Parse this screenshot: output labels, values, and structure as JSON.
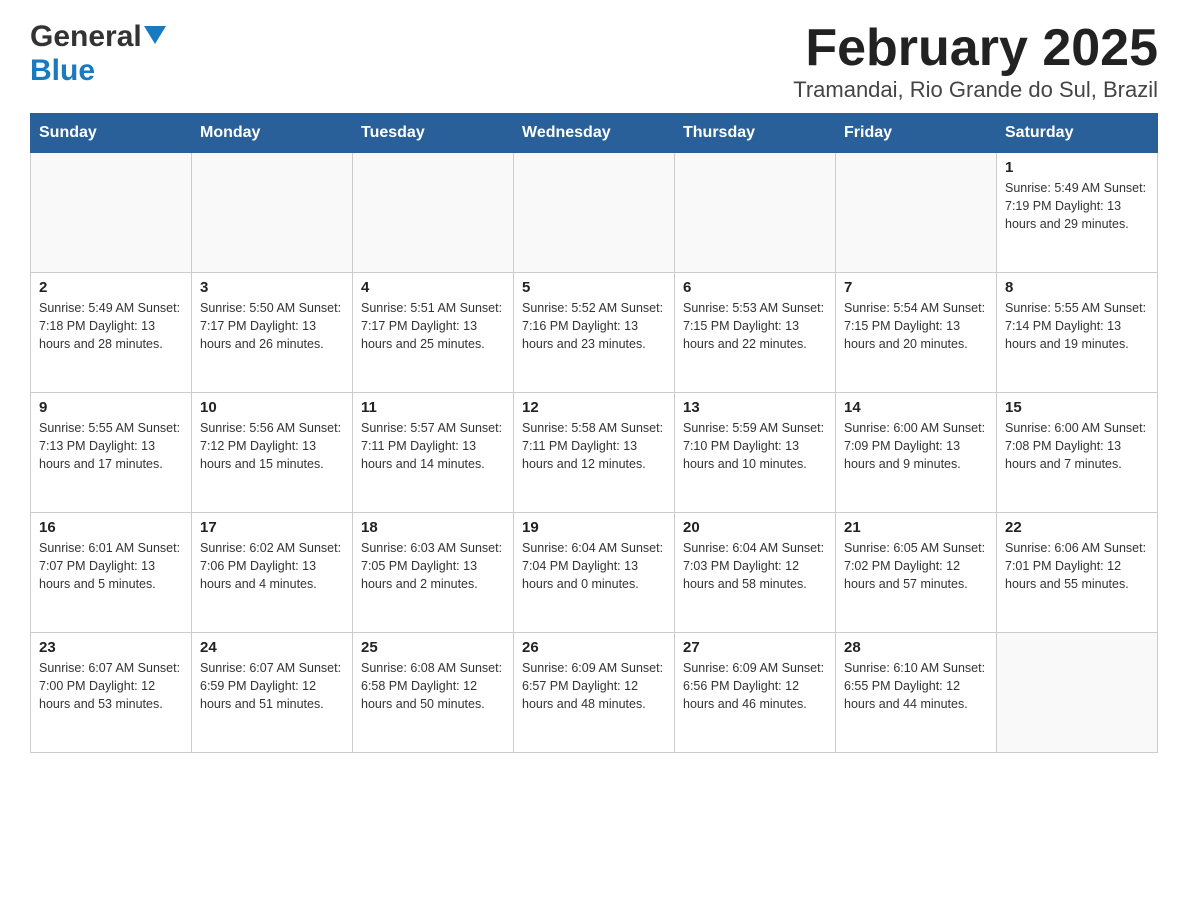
{
  "header": {
    "logo_general": "General",
    "logo_blue": "Blue",
    "title": "February 2025",
    "subtitle": "Tramandai, Rio Grande do Sul, Brazil"
  },
  "days_of_week": [
    "Sunday",
    "Monday",
    "Tuesday",
    "Wednesday",
    "Thursday",
    "Friday",
    "Saturday"
  ],
  "weeks": [
    [
      {
        "day": "",
        "info": ""
      },
      {
        "day": "",
        "info": ""
      },
      {
        "day": "",
        "info": ""
      },
      {
        "day": "",
        "info": ""
      },
      {
        "day": "",
        "info": ""
      },
      {
        "day": "",
        "info": ""
      },
      {
        "day": "1",
        "info": "Sunrise: 5:49 AM\nSunset: 7:19 PM\nDaylight: 13 hours and 29 minutes."
      }
    ],
    [
      {
        "day": "2",
        "info": "Sunrise: 5:49 AM\nSunset: 7:18 PM\nDaylight: 13 hours and 28 minutes."
      },
      {
        "day": "3",
        "info": "Sunrise: 5:50 AM\nSunset: 7:17 PM\nDaylight: 13 hours and 26 minutes."
      },
      {
        "day": "4",
        "info": "Sunrise: 5:51 AM\nSunset: 7:17 PM\nDaylight: 13 hours and 25 minutes."
      },
      {
        "day": "5",
        "info": "Sunrise: 5:52 AM\nSunset: 7:16 PM\nDaylight: 13 hours and 23 minutes."
      },
      {
        "day": "6",
        "info": "Sunrise: 5:53 AM\nSunset: 7:15 PM\nDaylight: 13 hours and 22 minutes."
      },
      {
        "day": "7",
        "info": "Sunrise: 5:54 AM\nSunset: 7:15 PM\nDaylight: 13 hours and 20 minutes."
      },
      {
        "day": "8",
        "info": "Sunrise: 5:55 AM\nSunset: 7:14 PM\nDaylight: 13 hours and 19 minutes."
      }
    ],
    [
      {
        "day": "9",
        "info": "Sunrise: 5:55 AM\nSunset: 7:13 PM\nDaylight: 13 hours and 17 minutes."
      },
      {
        "day": "10",
        "info": "Sunrise: 5:56 AM\nSunset: 7:12 PM\nDaylight: 13 hours and 15 minutes."
      },
      {
        "day": "11",
        "info": "Sunrise: 5:57 AM\nSunset: 7:11 PM\nDaylight: 13 hours and 14 minutes."
      },
      {
        "day": "12",
        "info": "Sunrise: 5:58 AM\nSunset: 7:11 PM\nDaylight: 13 hours and 12 minutes."
      },
      {
        "day": "13",
        "info": "Sunrise: 5:59 AM\nSunset: 7:10 PM\nDaylight: 13 hours and 10 minutes."
      },
      {
        "day": "14",
        "info": "Sunrise: 6:00 AM\nSunset: 7:09 PM\nDaylight: 13 hours and 9 minutes."
      },
      {
        "day": "15",
        "info": "Sunrise: 6:00 AM\nSunset: 7:08 PM\nDaylight: 13 hours and 7 minutes."
      }
    ],
    [
      {
        "day": "16",
        "info": "Sunrise: 6:01 AM\nSunset: 7:07 PM\nDaylight: 13 hours and 5 minutes."
      },
      {
        "day": "17",
        "info": "Sunrise: 6:02 AM\nSunset: 7:06 PM\nDaylight: 13 hours and 4 minutes."
      },
      {
        "day": "18",
        "info": "Sunrise: 6:03 AM\nSunset: 7:05 PM\nDaylight: 13 hours and 2 minutes."
      },
      {
        "day": "19",
        "info": "Sunrise: 6:04 AM\nSunset: 7:04 PM\nDaylight: 13 hours and 0 minutes."
      },
      {
        "day": "20",
        "info": "Sunrise: 6:04 AM\nSunset: 7:03 PM\nDaylight: 12 hours and 58 minutes."
      },
      {
        "day": "21",
        "info": "Sunrise: 6:05 AM\nSunset: 7:02 PM\nDaylight: 12 hours and 57 minutes."
      },
      {
        "day": "22",
        "info": "Sunrise: 6:06 AM\nSunset: 7:01 PM\nDaylight: 12 hours and 55 minutes."
      }
    ],
    [
      {
        "day": "23",
        "info": "Sunrise: 6:07 AM\nSunset: 7:00 PM\nDaylight: 12 hours and 53 minutes."
      },
      {
        "day": "24",
        "info": "Sunrise: 6:07 AM\nSunset: 6:59 PM\nDaylight: 12 hours and 51 minutes."
      },
      {
        "day": "25",
        "info": "Sunrise: 6:08 AM\nSunset: 6:58 PM\nDaylight: 12 hours and 50 minutes."
      },
      {
        "day": "26",
        "info": "Sunrise: 6:09 AM\nSunset: 6:57 PM\nDaylight: 12 hours and 48 minutes."
      },
      {
        "day": "27",
        "info": "Sunrise: 6:09 AM\nSunset: 6:56 PM\nDaylight: 12 hours and 46 minutes."
      },
      {
        "day": "28",
        "info": "Sunrise: 6:10 AM\nSunset: 6:55 PM\nDaylight: 12 hours and 44 minutes."
      },
      {
        "day": "",
        "info": ""
      }
    ]
  ]
}
